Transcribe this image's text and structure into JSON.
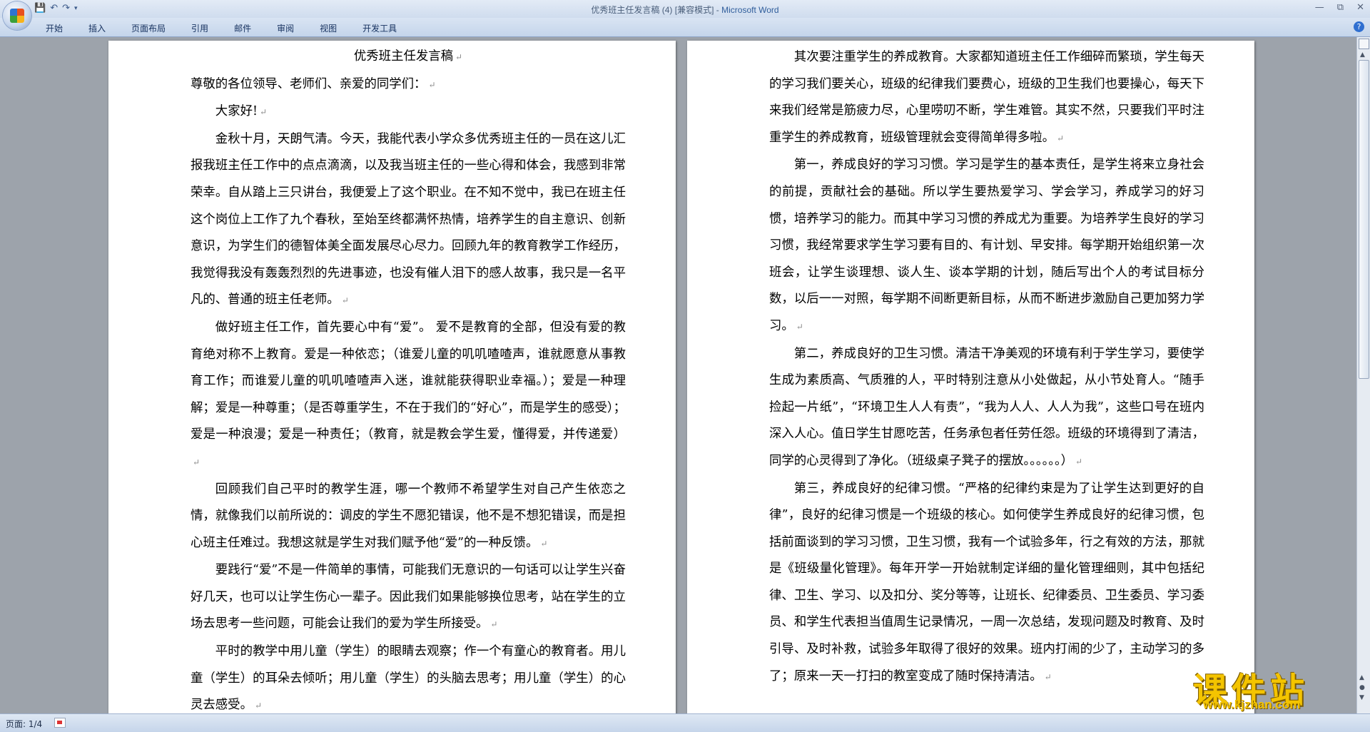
{
  "window": {
    "title": "优秀班主任发言稿 (4) [兼容模式]",
    "app_name": "Microsoft Word"
  },
  "quick_access": [
    "save-icon",
    "undo-icon",
    "redo-icon",
    "customize-icon"
  ],
  "ribbon": {
    "tabs": [
      "开始",
      "插入",
      "页面布局",
      "引用",
      "邮件",
      "审阅",
      "视图",
      "开发工具"
    ]
  },
  "document": {
    "page1": {
      "title": "优秀班主任发言稿",
      "paragraphs": [
        "尊敬的各位领导、老师们、亲爱的同学们：",
        "大家好!",
        "金秋十月，天朗气清。今天，我能代表小学众多优秀班主任的一员在这儿汇报我班主任工作中的点点滴滴，以及我当班主任的一些心得和体会，我感到非常荣幸。自从踏上三只讲台，我便爱上了这个职业。在不知不觉中，我已在班主任这个岗位上工作了九个春秋，至始至终都满怀热情，培养学生的自主意识、创新意识，为学生们的德智体美全面发展尽心尽力。回顾九年的教育教学工作经历，我觉得我没有轰轰烈烈的先进事迹，也没有催人泪下的感人故事，我只是一名平凡的、普通的班主任老师。",
        "做好班主任工作，首先要心中有“爱”。 爱不是教育的全部，但没有爱的教育绝对称不上教育。爱是一种依恋；（谁爱儿童的叽叽喳喳声，谁就愿意从事教育工作；而谁爱儿童的叽叽喳喳声入迷，谁就能获得职业幸福。）；爱是一种理解；爱是一种尊重；（是否尊重学生，不在于我们的“好心”，而是学生的感受）；爱是一种浪漫；爱是一种责任；（教育，就是教会学生爱，懂得爱，并传递爱）",
        "回顾我们自己平时的教学生涯，哪一个教师不希望学生对自己产生依恋之情，就像我们以前所说的：调皮的学生不愿犯错误，他不是不想犯错误，而是担心班主任难过。我想这就是学生对我们赋予他“爱”的一种反馈。",
        "要践行“爱”不是一件简单的事情，可能我们无意识的一句话可以让学生兴奋好几天，也可以让学生伤心一辈子。因此我们如果能够换位思考，站在学生的立场去思考一些问题，可能会让我们的爱为学生所接受。",
        "平时的教学中用儿童（学生）的眼睛去观察；作一个有童心的教育者。用儿童（学生）的耳朵去倾听；用儿童（学生）的头脑去思考；用儿童（学生）的心灵去感受。"
      ]
    },
    "page2": {
      "paragraphs": [
        "其次要注重学生的养成教育。大家都知道班主任工作细碎而繁琐，学生每天的学习我们要关心，班级的纪律我们要费心，班级的卫生我们也要操心，每天下来我们经常是筋疲力尽，心里唠叨不断，学生难管。其实不然，只要我们平时注重学生的养成教育，班级管理就会变得简单得多啦。",
        "第一，养成良好的学习习惯。学习是学生的基本责任，是学生将来立身社会的前提，贡献社会的基础。所以学生要热爱学习、学会学习，养成学习的好习惯，培养学习的能力。而其中学习习惯的养成尤为重要。为培养学生良好的学习习惯，我经常要求学生学习要有目的、有计划、早安排。每学期开始组织第一次班会，让学生谈理想、谈人生、谈本学期的计划，随后写出个人的考试目标分数，以后一一对照，每学期不间断更新目标，从而不断进步激励自己更加努力学习。",
        "第二，养成良好的卫生习惯。清洁干净美观的环境有利于学生学习，要使学生成为素质高、气质雅的人，平时特别注意从小处做起，从小节处育人。“随手捡起一片纸”，“环境卫生人人有责”，“我为人人、人人为我”，这些口号在班内深入人心。值日学生甘愿吃苦，任务承包者任劳任怨。班级的环境得到了清洁，同学的心灵得到了净化。（班级桌子凳子的摆放。。。。。。）",
        "第三，养成良好的纪律习惯。“严格的纪律约束是为了让学生达到更好的自律”，良好的纪律习惯是一个班级的核心。如何使学生养成良好的纪律习惯，包括前面谈到的学习习惯，卫生习惯，我有一个试验多年，行之有效的方法，那就是《班级量化管理》。每年开学一开始就制定详细的量化管理细则，其中包括纪律、卫生、学习、以及扣分、奖分等等，让班长、纪律委员、卫生委员、学习委员、和学生代表担当值周生记录情况，一周一次总结，发现问题及时教育、及时引导、及时补救，试验多年取得了很好的效果。班内打闹的少了，主动学习的多了；原来一天一打扫的教室变成了随时保持清洁。"
      ]
    },
    "paragraph_mark": "↵"
  },
  "statusbar": {
    "page_indicator": "页面: 1/4"
  },
  "watermark": {
    "text": "课件站",
    "url": "www.kjzhan.com"
  }
}
